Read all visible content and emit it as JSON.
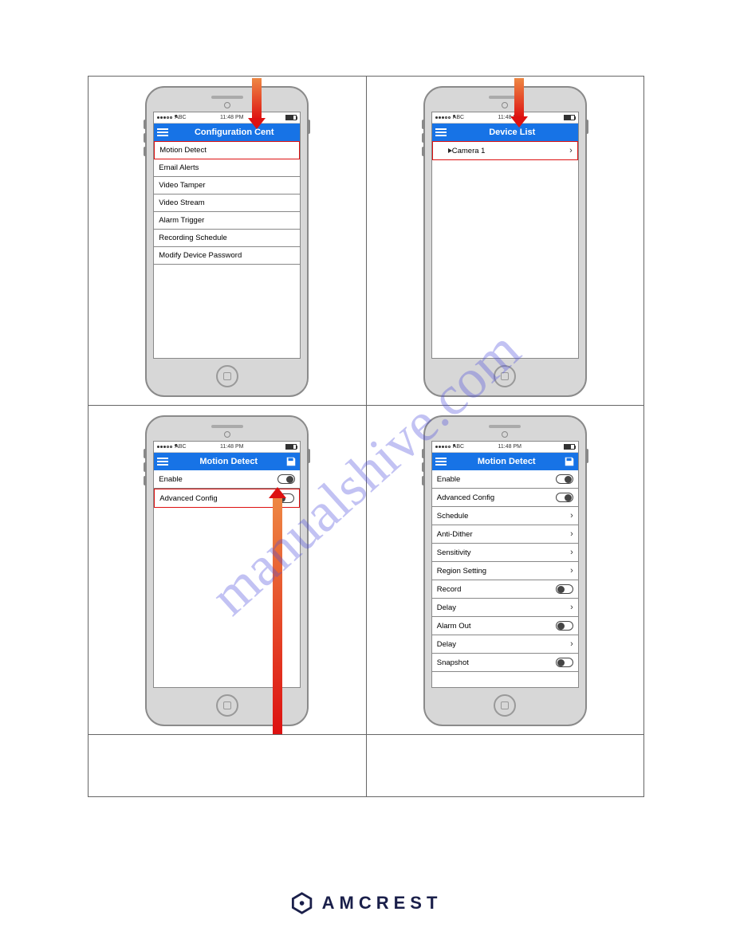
{
  "watermark": "manualshive.com",
  "brand": "AMCREST",
  "status": {
    "carrier": "ABC",
    "time": "11:48 PM"
  },
  "screens": {
    "s1": {
      "title": "Configuration Cent",
      "items": [
        "Motion Detect",
        "Email Alerts",
        "Video Tamper",
        "Video Stream",
        "Alarm Trigger",
        "Recording Schedule",
        "Modify Device Password"
      ]
    },
    "s2": {
      "title": "Device List",
      "items": [
        {
          "label": "Camera 1"
        }
      ]
    },
    "s3": {
      "title": "Motion Detect",
      "rows": [
        {
          "label": "Enable",
          "type": "toggle",
          "on": true
        },
        {
          "label": "Advanced Config",
          "type": "toggle",
          "on": false,
          "hl": true
        }
      ]
    },
    "s4": {
      "title": "Motion Detect",
      "rows": [
        {
          "label": "Enable",
          "type": "toggle",
          "on": true
        },
        {
          "label": "Advanced Config",
          "type": "toggle",
          "on": true
        },
        {
          "label": "Schedule",
          "type": "chev"
        },
        {
          "label": "Anti-Dither",
          "type": "chev"
        },
        {
          "label": "Sensitivity",
          "type": "chev"
        },
        {
          "label": "Region Setting",
          "type": "chev"
        },
        {
          "label": "Record",
          "type": "toggle",
          "on": false
        },
        {
          "label": "Delay",
          "type": "chev"
        },
        {
          "label": "Alarm Out",
          "type": "toggle",
          "on": false
        },
        {
          "label": "Delay",
          "type": "chev"
        },
        {
          "label": "Snapshot",
          "type": "toggle",
          "on": false
        }
      ]
    }
  }
}
